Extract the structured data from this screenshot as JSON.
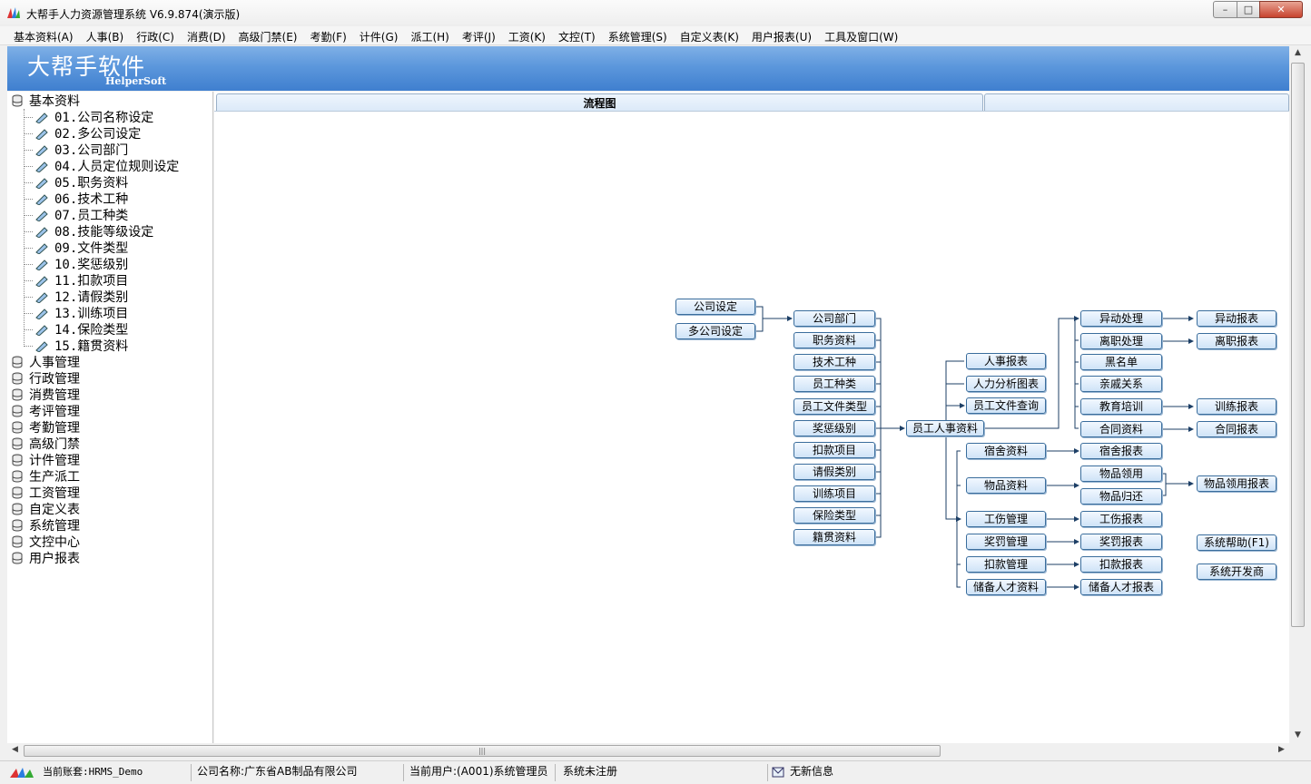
{
  "window": {
    "title": "大帮手人力资源管理系统 V6.9.874(演示版)",
    "controls": {
      "minimize": "–",
      "maximize": "□",
      "close": "✕"
    }
  },
  "menu": [
    "基本资料(A)",
    "人事(B)",
    "行政(C)",
    "消费(D)",
    "高级门禁(E)",
    "考勤(F)",
    "计件(G)",
    "派工(H)",
    "考评(J)",
    "工资(K)",
    "文控(T)",
    "系统管理(S)",
    "自定义表(K)",
    "用户报表(U)",
    "工具及窗口(W)"
  ],
  "banner": {
    "title": "大帮手软件",
    "subtitle": "HelperSoft"
  },
  "tree": {
    "root": "基本资料",
    "children": [
      "01.公司名称设定",
      "02.多公司设定",
      "03.公司部门",
      "04.人员定位规则设定",
      "05.职务资料",
      "06.技术工种",
      "07.员工种类",
      "08.技能等级设定",
      "09.文件类型",
      "10.奖惩级别",
      "11.扣款项目",
      "12.请假类别",
      "13.训练项目",
      "14.保险类型",
      "15.籍贯资料"
    ],
    "groups": [
      "人事管理",
      "行政管理",
      "消费管理",
      "考评管理",
      "考勤管理",
      "高级门禁",
      "计件管理",
      "生产派工",
      "工资管理",
      "自定义表",
      "系统管理",
      "文控中心",
      "用户报表"
    ]
  },
  "tabs": {
    "active": "流程图",
    "other": ""
  },
  "flow": {
    "company": [
      "公司设定",
      "多公司设定"
    ],
    "basic": [
      "公司部门",
      "职务资料",
      "技术工种",
      "员工种类",
      "员工文件类型",
      "奖惩级别",
      "扣款项目",
      "请假类别",
      "训练项目",
      "保险类型",
      "籍贯资料"
    ],
    "hub": "员工人事资料",
    "reports": [
      "人事报表",
      "人力分析图表",
      "员工文件查询"
    ],
    "hr": [
      "异动处理",
      "离职处理",
      "黑名单",
      "亲戚关系",
      "教育培训",
      "合同资料"
    ],
    "hr_reports": [
      "异动报表",
      "离职报表",
      "训练报表",
      "合同报表"
    ],
    "admin": [
      "宿舍资料",
      "物品资料",
      "工伤管理",
      "奖罚管理",
      "扣款管理",
      "储备人才资料"
    ],
    "goods": [
      "物品领用",
      "物品归还"
    ],
    "admin_reports": [
      "宿舍报表",
      "物品领用报表",
      "工伤报表",
      "奖罚报表",
      "扣款报表",
      "储备人才报表"
    ],
    "misc": [
      "系统帮助(F1)",
      "系统开发商"
    ]
  },
  "status": {
    "account": "当前账套:HRMS_Demo",
    "company": "公司名称:广东省AB制品有限公司",
    "user": "当前用户:(A001)系统管理员",
    "reg": "系统未注册",
    "msg": "无新信息"
  }
}
